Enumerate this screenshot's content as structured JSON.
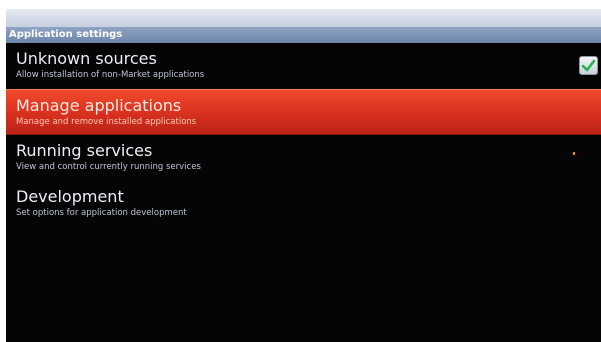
{
  "header": {
    "title": "Application settings"
  },
  "settings": {
    "items": [
      {
        "title": "Unknown sources",
        "subtitle": "Allow installation of non-Market applications",
        "checked": true
      },
      {
        "title": "Manage applications",
        "subtitle": "Manage and remove installed applications",
        "selected": true
      },
      {
        "title": "Running services",
        "subtitle": "View and control currently running services"
      },
      {
        "title": "Development",
        "subtitle": "Set options for application development"
      }
    ]
  },
  "colors": {
    "highlight": "#d8301f",
    "header_bar": "#7b90b6",
    "checkmark": "#2bb24a"
  },
  "icons": {
    "checkbox": "check-icon"
  }
}
